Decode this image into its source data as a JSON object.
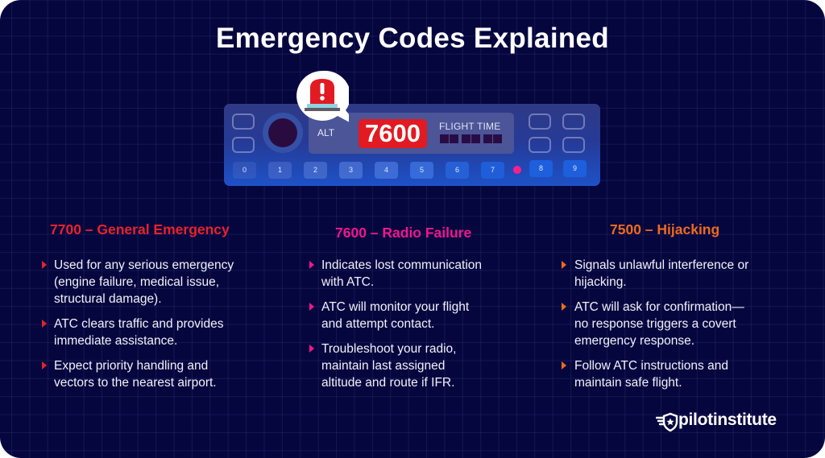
{
  "title": "Emergency Codes Explained",
  "transponder": {
    "alt_label": "ALT",
    "squawk_code": "7600",
    "flight_time_label": "FLIGHT TIME",
    "keys": [
      "0",
      "1",
      "2",
      "3",
      "4",
      "5",
      "6",
      "7",
      "8",
      "9"
    ],
    "alert_icon": "siren-icon"
  },
  "columns": [
    {
      "heading": "7700 – General Emergency",
      "color": "#e8222a",
      "bullets": [
        [
          "Used for any serious emergency",
          "(engine failure, medical issue,",
          "structural damage)."
        ],
        [
          "ATC clears traffic and provides",
          "immediate assistance."
        ],
        [
          "Expect priority handling and",
          "vectors to the nearest airport."
        ]
      ]
    },
    {
      "heading": "7600 – Radio Failure",
      "color": "#f0168c",
      "bullets": [
        [
          "Indicates lost communication",
          "with ATC."
        ],
        [
          "ATC will monitor your flight",
          "and attempt contact."
        ],
        [
          "Troubleshoot your radio,",
          "maintain last assigned",
          "altitude and route if IFR."
        ]
      ]
    },
    {
      "heading": "7500 – Hijacking",
      "color": "#ee6a1c",
      "bullets": [
        [
          "Signals unlawful interference or",
          "hijacking."
        ],
        [
          "ATC will ask for confirmation—",
          "no response triggers a covert",
          "emergency response."
        ],
        [
          "Follow ATC instructions and",
          "maintain safe flight."
        ]
      ]
    }
  ],
  "brand": {
    "name": "pilotinstitute",
    "icon": "winged-star-shield-icon"
  },
  "colors": {
    "background": "#06063f",
    "code_display": "#e21a22",
    "indicator_led": "#ff1e8a"
  }
}
